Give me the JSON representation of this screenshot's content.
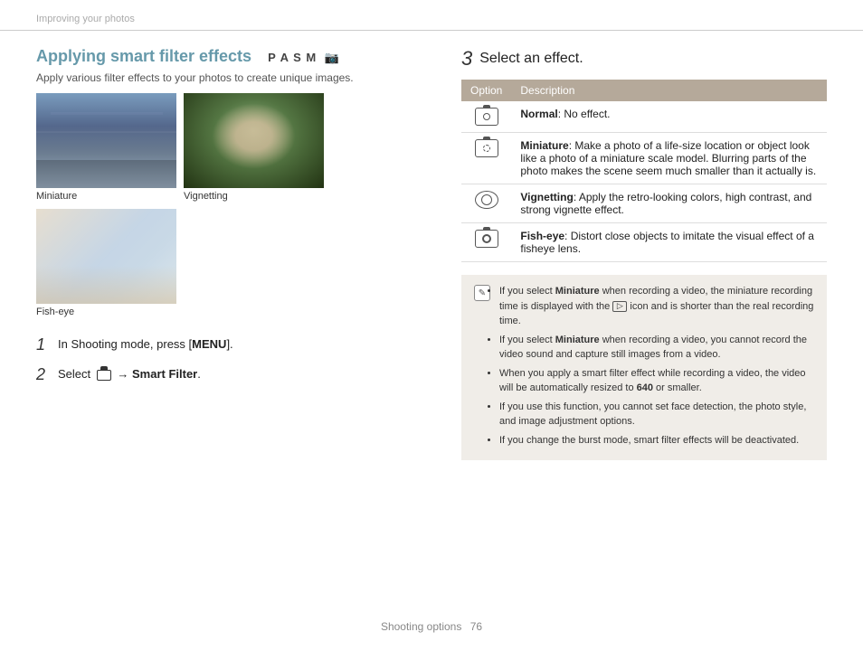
{
  "breadcrumb": {
    "text": "Improving your photos"
  },
  "left": {
    "title": "Applying smart filter effects",
    "mode": "P A S M",
    "subtitle": "Apply various filter effects to your photos to create unique images.",
    "photos": [
      {
        "label": "Miniature"
      },
      {
        "label": "Vignetting"
      },
      {
        "label": "Fish-eye"
      }
    ],
    "steps": [
      {
        "num": "1",
        "text": "In Shooting mode, press [",
        "bold": "MENU",
        "after": "]."
      },
      {
        "num": "2",
        "text_before": "Select ",
        "icon": "camera",
        "text_after": " → ",
        "bold": "Smart Filter",
        "period": "."
      }
    ]
  },
  "right": {
    "step_num": "3",
    "step_label": "Select an effect.",
    "table": {
      "headers": [
        "Option",
        "Description"
      ],
      "rows": [
        {
          "icon": "camera-alt",
          "option_name": "Normal",
          "description": ": No effect."
        },
        {
          "icon": "miniature-icon",
          "option_name": "Miniature",
          "description": ": Make a photo of a life-size location or object look like a photo of a miniature scale model. Blurring parts of the photo makes the scene seem much smaller than it actually is."
        },
        {
          "icon": "vignetting-icon",
          "option_name": "Vignetting",
          "description": ": Apply the retro-looking colors, high contrast, and strong vignette effect."
        },
        {
          "icon": "fisheye-icon",
          "option_name": "Fish-eye",
          "description": ": Distort close objects to imitate the visual effect of a fisheye lens."
        }
      ]
    },
    "notes": {
      "icon": "info",
      "items": [
        "If you select Miniature when recording a video, the miniature recording time is displayed with the  icon and is shorter than the real recording time.",
        "If you select Miniature when recording a video, you cannot record the video sound and capture still images from a video.",
        "When you apply a smart filter effect while recording a video, the video will be automatically resized to 640 or smaller.",
        "If you use this function, you cannot set face detection, the photo style, and image adjustment options.",
        "If you change the burst mode, smart filter effects will be deactivated."
      ],
      "miniature_bold": "Miniature",
      "miniature2_bold": "Miniature"
    }
  },
  "footer": {
    "text": "Shooting options",
    "page": "76"
  }
}
